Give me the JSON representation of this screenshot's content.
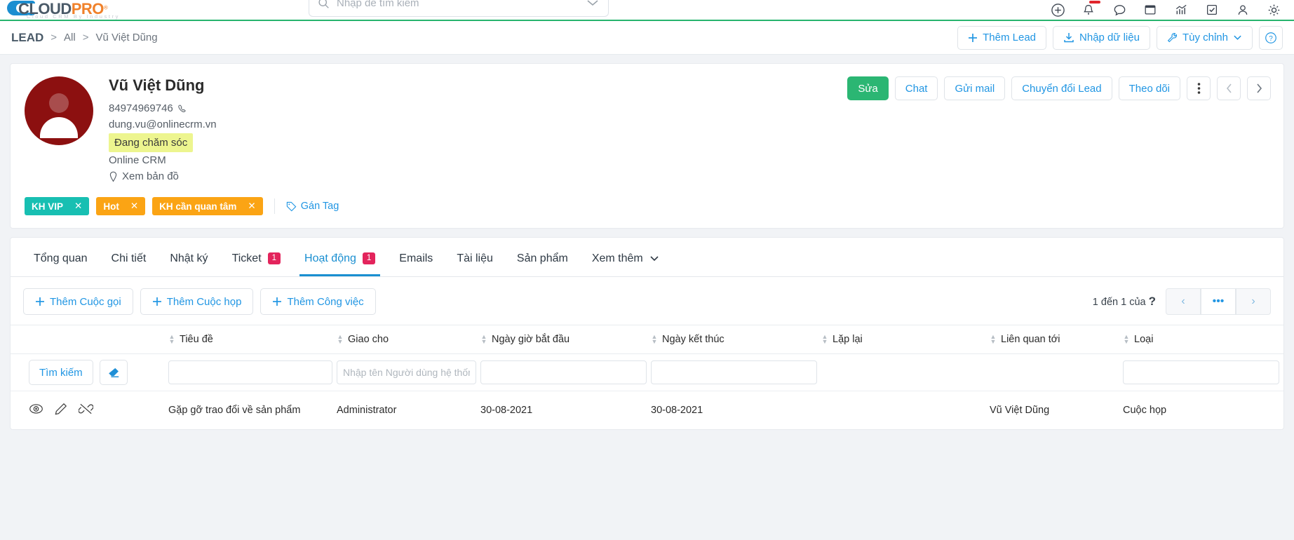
{
  "topbar": {
    "logo": {
      "part1": "CLOUD",
      "part2": "PRO",
      "registered": "®",
      "tagline": "Cloud CRM By Industry"
    },
    "search": {
      "placeholder": "Nhập để tìm kiếm",
      "value": ""
    },
    "icons": [
      {
        "name": "add-circle-icon",
        "glyph": "⊕"
      },
      {
        "name": "notification-bell-icon",
        "glyph": "🔔"
      },
      {
        "name": "chat-bubble-icon",
        "glyph": "💬"
      },
      {
        "name": "window-icon",
        "glyph": "■"
      },
      {
        "name": "analytics-chart-icon",
        "glyph": "📊"
      },
      {
        "name": "checkbox-task-icon",
        "glyph": "☑"
      },
      {
        "name": "user-account-icon",
        "glyph": "👤"
      },
      {
        "name": "settings-gear-icon",
        "glyph": "⚙"
      }
    ]
  },
  "breadcrumb": {
    "root": "LEAD",
    "separator": ">",
    "items": [
      "All",
      "Vũ Việt Dũng"
    ],
    "actions": [
      {
        "name": "add-lead-button",
        "label": "Thêm Lead",
        "icon": "plus-icon"
      },
      {
        "name": "import-data-button",
        "label": "Nhập dữ liệu",
        "icon": "download-icon"
      },
      {
        "name": "customize-button",
        "label": "Tùy chỉnh",
        "icon": "wrench-icon"
      },
      {
        "name": "help-button",
        "label": "",
        "icon": "help-circle-icon"
      }
    ]
  },
  "profile": {
    "name": "Vũ Việt Dũng",
    "phone": "84974969746",
    "email": "dung.vu@onlinecrm.vn",
    "status": "Đang chăm sóc",
    "company": "Online CRM",
    "map_link": "Xem bản đồ",
    "avatar_color": "#8c1010",
    "status_highlight_color": "#edf58f",
    "actions": [
      {
        "name": "edit-button",
        "label": "Sửa",
        "primary": true
      },
      {
        "name": "chat-button",
        "label": "Chat",
        "primary": false
      },
      {
        "name": "send-mail-button",
        "label": "Gửi mail",
        "primary": false
      },
      {
        "name": "convert-lead-button",
        "label": "Chuyển đổi Lead",
        "primary": false
      },
      {
        "name": "follow-button",
        "label": "Theo dõi",
        "primary": false
      }
    ],
    "tags": [
      {
        "label": "KH VIP",
        "color": "#18bfb2"
      },
      {
        "label": "Hot",
        "color": "#fba414"
      },
      {
        "label": "KH cần quan tâm",
        "color": "#fba414"
      }
    ],
    "assign_tag_label": "Gán Tag"
  },
  "tabs": [
    {
      "label": "Tổng quan",
      "badge": "",
      "active": false
    },
    {
      "label": "Chi tiết",
      "badge": "",
      "active": false
    },
    {
      "label": "Nhật ký",
      "badge": "",
      "active": false
    },
    {
      "label": "Ticket",
      "badge": "1",
      "active": false
    },
    {
      "label": "Hoạt động",
      "badge": "1",
      "active": true
    },
    {
      "label": "Emails",
      "badge": "",
      "active": false
    },
    {
      "label": "Tài liệu",
      "badge": "",
      "active": false
    },
    {
      "label": "Sản phẩm",
      "badge": "",
      "active": false
    },
    {
      "label": "Xem thêm",
      "badge": "",
      "active": false
    }
  ],
  "activity": {
    "buttons": [
      {
        "name": "add-call-button",
        "label": "Thêm Cuộc gọi"
      },
      {
        "name": "add-meeting-button",
        "label": "Thêm Cuộc họp"
      },
      {
        "name": "add-task-button",
        "label": "Thêm Công việc"
      }
    ],
    "pagination": {
      "text": "1 đến 1 của",
      "total": "?",
      "prev": "‹",
      "more": "•••",
      "next": "›"
    },
    "search_button": "Tìm kiếm",
    "columns": [
      {
        "key": "actions",
        "label": ""
      },
      {
        "key": "title",
        "label": "Tiêu đề"
      },
      {
        "key": "assigned",
        "label": "Giao cho"
      },
      {
        "key": "start",
        "label": "Ngày giờ bắt đầu"
      },
      {
        "key": "end",
        "label": "Ngày kết thúc"
      },
      {
        "key": "repeat",
        "label": "Lặp lại"
      },
      {
        "key": "related",
        "label": "Liên quan tới"
      },
      {
        "key": "type",
        "label": "Loại"
      }
    ],
    "filters": {
      "title": {
        "value": "",
        "placeholder": ""
      },
      "assigned": {
        "value": "",
        "placeholder": "Nhập tên Người dùng hệ thống"
      },
      "start": {
        "value": "",
        "placeholder": ""
      },
      "end": {
        "value": "",
        "placeholder": ""
      },
      "repeat": {
        "value": "",
        "placeholder": ""
      },
      "related": {
        "value": "",
        "placeholder": ""
      },
      "type": {
        "value": "",
        "placeholder": ""
      }
    },
    "rows": [
      {
        "title": "Gặp gỡ trao đổi về sản phẩm",
        "assigned": "Administrator",
        "start": "30-08-2021",
        "end": "30-08-2021",
        "repeat": "",
        "related": "Vũ Việt Dũng",
        "type": "Cuộc họp"
      }
    ]
  }
}
